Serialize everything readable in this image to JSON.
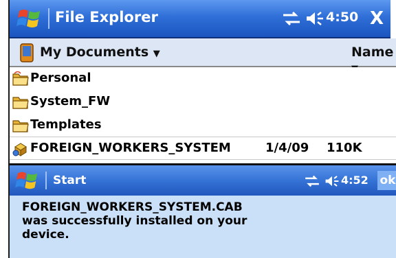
{
  "titlebar": {
    "title": "File Explorer",
    "time": "4:50",
    "close_label": "X",
    "icons": [
      "windows-start-icon",
      "connectivity-icon",
      "speaker-icon"
    ],
    "color": "#2f6fd7"
  },
  "folderbar": {
    "folder": "My Documents",
    "sort_by": "Name",
    "icons": [
      "device-icon",
      "dropdown-arrow-icon"
    ]
  },
  "files": [
    {
      "name": "Personal",
      "date": "",
      "size": "",
      "icon": "folder-icon"
    },
    {
      "name": "System_FW",
      "date": "",
      "size": "",
      "icon": "folder-icon"
    },
    {
      "name": "Templates",
      "date": "",
      "size": "",
      "icon": "folder-icon"
    },
    {
      "name": "FOREIGN_WORKERS_SYSTEM",
      "date": "1/4/09",
      "size": "110K",
      "icon": "cab-file-icon"
    }
  ],
  "notification": {
    "title": "Start",
    "time": "4:52",
    "ok_label": "ok",
    "message": "FOREIGN_WORKERS_SYSTEM.CAB\nwas successfully installed on your\ndevice.",
    "body_color": "#c9e0f8"
  }
}
